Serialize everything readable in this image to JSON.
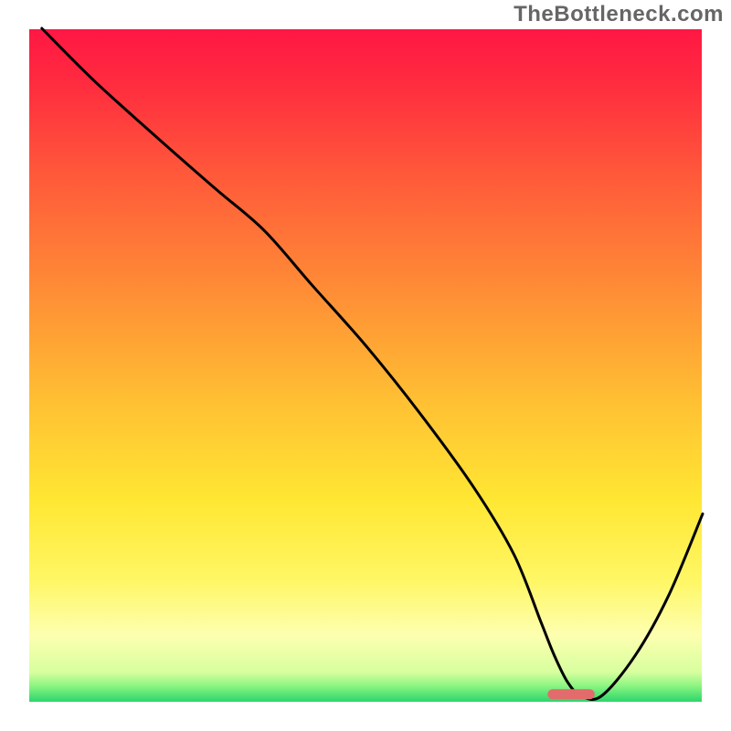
{
  "watermark": "TheBottleneck.com",
  "chart_data": {
    "type": "line",
    "title": "",
    "xlabel": "",
    "ylabel": "",
    "xlim": [
      0,
      100
    ],
    "ylim": [
      0,
      100
    ],
    "background_gradient": {
      "type": "linear-vertical",
      "stops": [
        {
          "offset": 0.0,
          "color": "#ff1744"
        },
        {
          "offset": 0.08,
          "color": "#ff2b3f"
        },
        {
          "offset": 0.22,
          "color": "#ff5a3a"
        },
        {
          "offset": 0.38,
          "color": "#ff8a36"
        },
        {
          "offset": 0.55,
          "color": "#ffbf33"
        },
        {
          "offset": 0.7,
          "color": "#ffe733"
        },
        {
          "offset": 0.82,
          "color": "#fff766"
        },
        {
          "offset": 0.9,
          "color": "#fdffb0"
        },
        {
          "offset": 0.955,
          "color": "#d7ff9e"
        },
        {
          "offset": 0.975,
          "color": "#8cf582"
        },
        {
          "offset": 1.0,
          "color": "#27d36a"
        }
      ]
    },
    "series": [
      {
        "name": "bottleneck-curve",
        "type": "line",
        "stroke": "#000000",
        "stroke_width": 3,
        "x": [
          2,
          10,
          20,
          28,
          35,
          42,
          50,
          58,
          66,
          72,
          76,
          78,
          80,
          82,
          85,
          90,
          95,
          100
        ],
        "y": [
          100,
          92,
          83,
          76,
          70,
          62,
          53,
          43,
          32,
          22,
          12,
          7,
          3,
          1,
          1,
          7,
          16,
          28
        ]
      }
    ],
    "optimal_range": {
      "name": "optimal-marker",
      "shape": "rounded-bar",
      "color": "#e36b6b",
      "x_start": 77,
      "x_end": 84,
      "y": 0.5,
      "height": 1.5
    }
  }
}
